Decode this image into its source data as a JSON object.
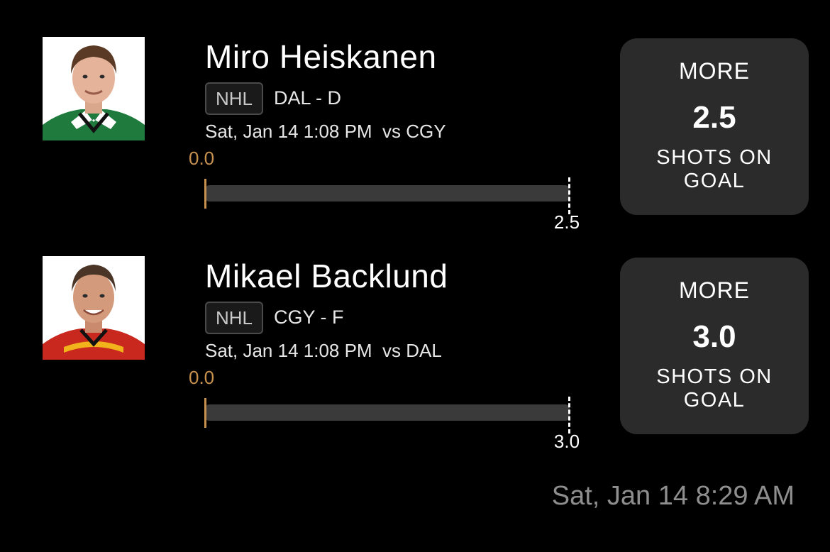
{
  "picks": [
    {
      "player_name": "Miro Heiskanen",
      "league": "NHL",
      "team_position": "DAL - D",
      "game_info": "Sat, Jan 14 1:08 PM  vs CGY",
      "current_value": "0.0",
      "progress_fraction": 0,
      "target_value": "2.5",
      "direction": "MORE",
      "line": "2.5",
      "stat": "SHOTS ON GOAL",
      "jersey_color": "#1f7a3d"
    },
    {
      "player_name": "Mikael Backlund",
      "league": "NHL",
      "team_position": "CGY - F",
      "game_info": "Sat, Jan 14 1:08 PM  vs DAL",
      "current_value": "0.0",
      "progress_fraction": 0,
      "target_value": "3.0",
      "direction": "MORE",
      "line": "3.0",
      "stat": "SHOTS ON GOAL",
      "jersey_color": "#c8281e"
    }
  ],
  "timestamp": "Sat, Jan 14 8:29 AM",
  "colors": {
    "background": "#000000",
    "card": "#2b2b2b",
    "accent": "#c8924e",
    "track": "#3a3a3a",
    "muted_text": "#8e8e8e"
  }
}
